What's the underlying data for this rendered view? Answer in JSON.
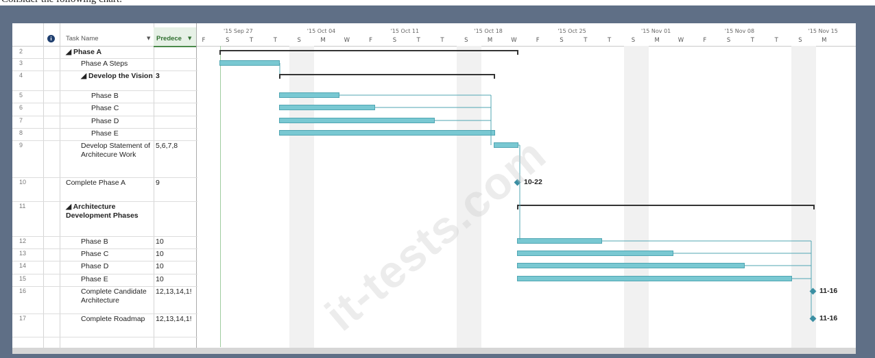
{
  "caption": "Consider the following chart:",
  "grid": {
    "indicator_icon": "info-icon",
    "col_task_name": "Task Name",
    "col_predecessors": "Predece",
    "dropdown_icon": "chevron-down-icon"
  },
  "timeline": {
    "weeks": [
      "'15 Sep 27",
      "'15 Oct 04",
      "'15 Oct 11",
      "'15 Oct 18",
      "'15 Oct 25",
      "'15 Nov 01",
      "'15 Nov 08",
      "'15 Nov 15"
    ],
    "days": [
      "F",
      "S",
      "T",
      "T",
      "S",
      "M",
      "W",
      "F",
      "S",
      "T",
      "T",
      "S",
      "M",
      "W",
      "F",
      "S",
      "T",
      "T",
      "S",
      "M",
      "W",
      "F",
      "S",
      "T",
      "T",
      "S",
      "M"
    ]
  },
  "rows": [
    {
      "id": "2",
      "name": "◢ Phase A",
      "pred": "",
      "bold": true,
      "indent": 0
    },
    {
      "id": "3",
      "name": "Phase A Steps",
      "pred": "",
      "bold": false,
      "indent": 1
    },
    {
      "id": "4",
      "name": "◢ Develop the Vision",
      "pred": "3",
      "bold": true,
      "indent": 1
    },
    {
      "id": "5",
      "name": "Phase B",
      "pred": "",
      "bold": false,
      "indent": 2
    },
    {
      "id": "6",
      "name": "Phase C",
      "pred": "",
      "bold": false,
      "indent": 2
    },
    {
      "id": "7",
      "name": "Phase D",
      "pred": "",
      "bold": false,
      "indent": 2
    },
    {
      "id": "8",
      "name": "Phase E",
      "pred": "",
      "bold": false,
      "indent": 2
    },
    {
      "id": "9",
      "name": "Develop Statement of Architecure Work",
      "pred": "5,6,7,8",
      "bold": false,
      "indent": 1
    },
    {
      "id": "10",
      "name": "Complete Phase A",
      "pred": "9",
      "bold": false,
      "indent": 0
    },
    {
      "id": "11",
      "name": "◢ Architecture Development Phases",
      "pred": "",
      "bold": true,
      "indent": 0
    },
    {
      "id": "12",
      "name": "Phase B",
      "pred": "10",
      "bold": false,
      "indent": 1
    },
    {
      "id": "13",
      "name": "Phase C",
      "pred": "10",
      "bold": false,
      "indent": 1
    },
    {
      "id": "14",
      "name": "Phase D",
      "pred": "10",
      "bold": false,
      "indent": 1
    },
    {
      "id": "15",
      "name": "Phase E",
      "pred": "10",
      "bold": false,
      "indent": 1
    },
    {
      "id": "16",
      "name": "Complete Candidate Architecture",
      "pred": "12,13,14,1!",
      "bold": false,
      "indent": 1
    },
    {
      "id": "17",
      "name": "Complete Roadmap",
      "pred": "12,13,14,1!",
      "bold": false,
      "indent": 1
    }
  ],
  "milestones": [
    {
      "row": "10",
      "label": "10-22"
    },
    {
      "row": "16",
      "label": "11-16"
    },
    {
      "row": "17",
      "label": "11-16"
    }
  ],
  "watermark": "it-tests.com",
  "colors": {
    "bar": "#79c8d2",
    "bar_border": "#4fa5b2",
    "summary": "#333333",
    "frame": "#5f6f86"
  }
}
